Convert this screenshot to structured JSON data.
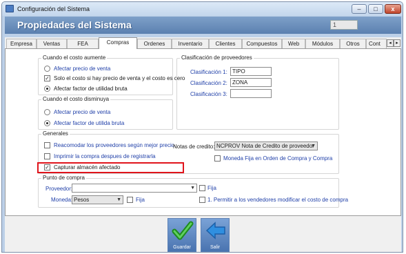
{
  "window": {
    "title": "Configuración del Sistema",
    "header_title": "Propiedades del Sistema",
    "header_value": "1",
    "controls": {
      "minimize": "–",
      "maximize": "□",
      "close": "x"
    }
  },
  "tabs": [
    "Empresa",
    "Ventas",
    "FEA",
    "Compras",
    "Ordenes",
    "Inventario",
    "Clientes",
    "Compuestos",
    "Web",
    "Módulos",
    "Otros",
    "Cont"
  ],
  "active_tab": "Compras",
  "tab_scroll": {
    "left": "◂",
    "right": "▸"
  },
  "costo_aumente": {
    "title": "Cuando el costo aumente",
    "options": [
      "Afectar precio de venta",
      "Afectar factor de utilidad bruta"
    ],
    "checkbox_label": "Solo el costo si hay precio de venta y el costo es cero",
    "checkbox_checked": true,
    "selected": "Afectar factor de utilidad bruta"
  },
  "costo_disminuya": {
    "title": "Cuando el costo disminuya",
    "options": [
      "Afectar precio de venta",
      "Afectar factor de utilida bruta"
    ],
    "selected": "Afectar factor de utilida bruta"
  },
  "clasificacion": {
    "title": "Clasificación de proveedores",
    "labels": [
      "Clasificación 1:",
      "Clasificación 2:",
      "Clasificación 3:"
    ],
    "values": [
      "TIPO",
      "ZONA",
      ""
    ]
  },
  "generales": {
    "title": "Generales",
    "reacomodar": "Reacomodar los proveedores según mejor precio",
    "imprimir": "Imprimir la compra despues de registrarla",
    "capturar": "Capturar almacén afectado",
    "capturar_checked": true,
    "notas_label": "Notas de credito:",
    "notas_value": "NCPROV Nota de Credito de proveedor",
    "moneda_fija": "Moneda Fija en Orden de Compra y Compra"
  },
  "punto_compra": {
    "title": "Punto de compra",
    "proveedor_label": "Proveedor:",
    "proveedor_value": "",
    "fija1": "Fija",
    "moneda_label": "Moneda:",
    "moneda_value": "Pesos",
    "fija2": "Fija",
    "permitir": "1. Permitir a los vendedores modificar el costo de compra"
  },
  "buttons": {
    "guardar": "Guardar",
    "salir": "Salir"
  },
  "colors": {
    "accent_red": "#e0141b",
    "header_blue": "#5b80b0",
    "label_blue": "#1f3fa8"
  }
}
